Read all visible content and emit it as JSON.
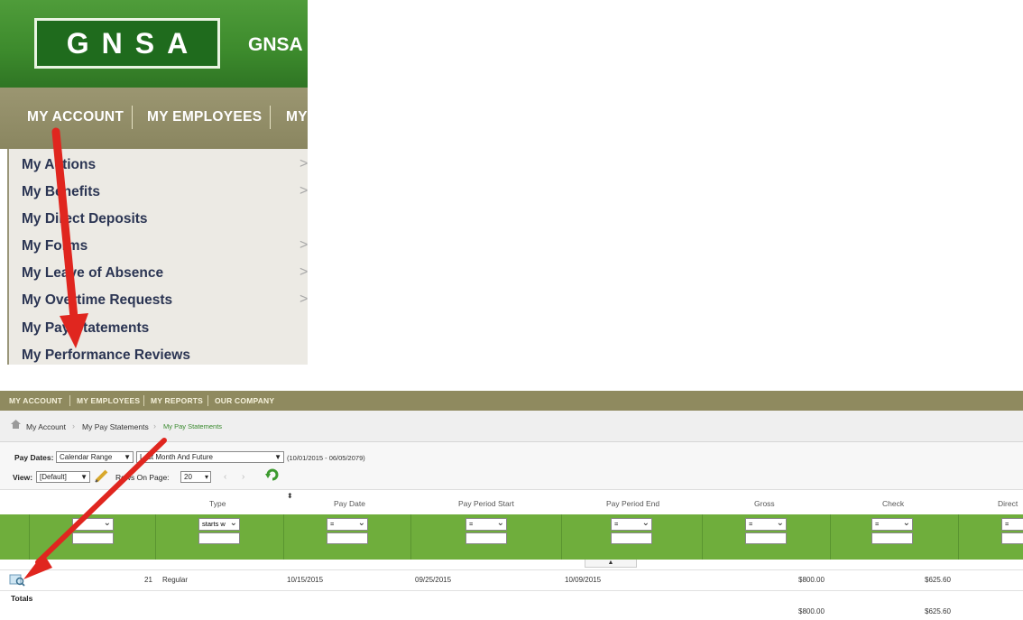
{
  "top_panel": {
    "logo": "GNSA",
    "logo_side": "GNSA",
    "nav": [
      "MY ACCOUNT",
      "MY EMPLOYEES",
      "MY"
    ],
    "menu_items": [
      {
        "label": "My Actions",
        "has_submenu": true
      },
      {
        "label": "My Benefits",
        "has_submenu": true
      },
      {
        "label": "My Direct Deposits",
        "has_submenu": false
      },
      {
        "label": "My Forms",
        "has_submenu": true
      },
      {
        "label": "My Leave of Absence",
        "has_submenu": true
      },
      {
        "label": "My Overtime Requests",
        "has_submenu": true
      },
      {
        "label": "My Pay Statements",
        "has_submenu": false
      },
      {
        "label": "My Performance Reviews",
        "has_submenu": false
      }
    ],
    "chevron": ">"
  },
  "bottom_panel": {
    "nav": [
      "MY ACCOUNT",
      "MY EMPLOYEES",
      "MY REPORTS",
      "OUR COMPANY"
    ],
    "breadcrumb": [
      "My Account",
      "My Pay Statements",
      "My Pay Statements"
    ],
    "pay_dates_label": "Pay Dates:",
    "pay_dates_mode": "Calendar Range",
    "pay_dates_range": "Last Month And Future",
    "pay_dates_span": "(10/01/2015 - 06/05/2079)",
    "view_label": "View:",
    "view_value": "[Default]",
    "rows_label": "Rows On Page:",
    "rows_value": "20",
    "columns": [
      "Type",
      "Pay Date",
      "Pay Period Start",
      "Pay Period End",
      "Gross",
      "Check",
      "Direct"
    ],
    "filter_type_value": "starts w",
    "filter_eq": "=",
    "row": {
      "number": "21",
      "type": "Regular",
      "pay_date": "10/15/2015",
      "period_start": "09/25/2015",
      "period_end": "10/09/2015",
      "gross": "$800.00",
      "check": "$625.60"
    },
    "totals_label": "Totals",
    "totals": {
      "gross": "$800.00",
      "check": "$625.60"
    }
  },
  "colors": {
    "header_green": "#3c8a2c",
    "nav_olive": "#8f8a5f",
    "filter_green": "#6fae3c",
    "arrow_red": "#e0261f",
    "menu_text": "#2b3553"
  }
}
